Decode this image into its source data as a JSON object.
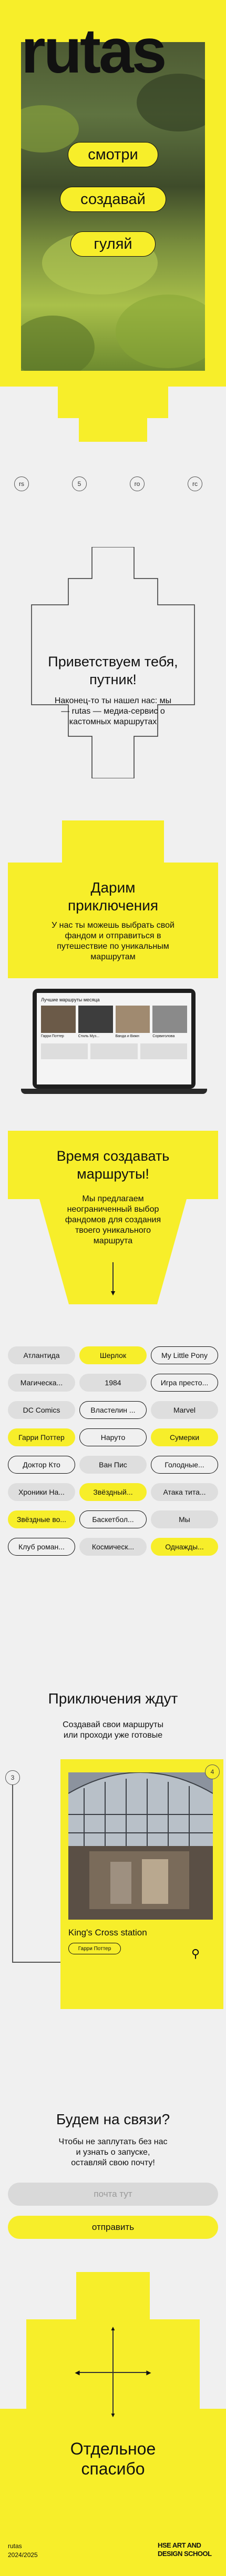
{
  "hero": {
    "logo": "rutas",
    "pills": [
      "смотри",
      "создавай",
      "гуляй"
    ]
  },
  "nav_dots": [
    "rs",
    "5",
    "ro",
    "rc"
  ],
  "welcome": {
    "title": "Приветствуем тебя, путник!",
    "text": "Наконец-то ты нашел нас: мы — rutas — медиа-сервис о кастомных маршрутах"
  },
  "gift": {
    "title": "Дарим приключения",
    "text": "У нас ты можешь выбрать свой фандом и отправиться в путешествие по уникальным маршрутам"
  },
  "laptop": {
    "heading": "Лучшие маршруты месяца",
    "cards": [
      "Гарри Поттер",
      "Стиль Муз...",
      "Ванда и Вижн",
      "Сорвиголова"
    ]
  },
  "create": {
    "title": "Время создавать маршруты!",
    "text": "Мы предлагаем неограниченный выбор фандомов для создания твоего уникального маршрута"
  },
  "tags": [
    [
      "Атлантида",
      "Шерлок",
      "My Little Pony"
    ],
    [
      "Магическа...",
      "1984",
      "Игра престо..."
    ],
    [
      "DC Comics",
      "Властелин ...",
      "Marvel"
    ],
    [
      "Гарри Поттер",
      "Наруто",
      "Сумерки"
    ],
    [
      "Доктор Кто",
      "Ван Пис",
      "Голодные..."
    ],
    [
      "Хроники На...",
      "Звёздный...",
      "Атака тита..."
    ],
    [
      "Звёздные во...",
      "Баскетбол...",
      "Мы"
    ],
    [
      "Клуб роман...",
      "Космическ...",
      "Однажды..."
    ]
  ],
  "adventures": {
    "title": "Приключения ждут",
    "text": "Создавай свои маршруты или проходи уже готовые",
    "step_left": "3",
    "step_right": "4",
    "card_title": "King's Cross station",
    "card_tag": "Гарри Поттер"
  },
  "contact": {
    "title": "Будем на связи?",
    "text": "Чтобы не заплутать без нас и узнать о запуске, оставляй свою почту!",
    "email_placeholder": "почта тут",
    "submit": "отправить"
  },
  "thanks": {
    "title": "Отдельное спасибо"
  },
  "footer": {
    "brand": "rutas",
    "years": "2024/2025",
    "school_line1": "HSE ART AND",
    "school_line2": "DESIGN SCHOOL"
  },
  "colors": {
    "accent": "#f7ee2a",
    "ink": "#111111",
    "background": "#f0f0f0",
    "tag_gray": "#dedede"
  }
}
